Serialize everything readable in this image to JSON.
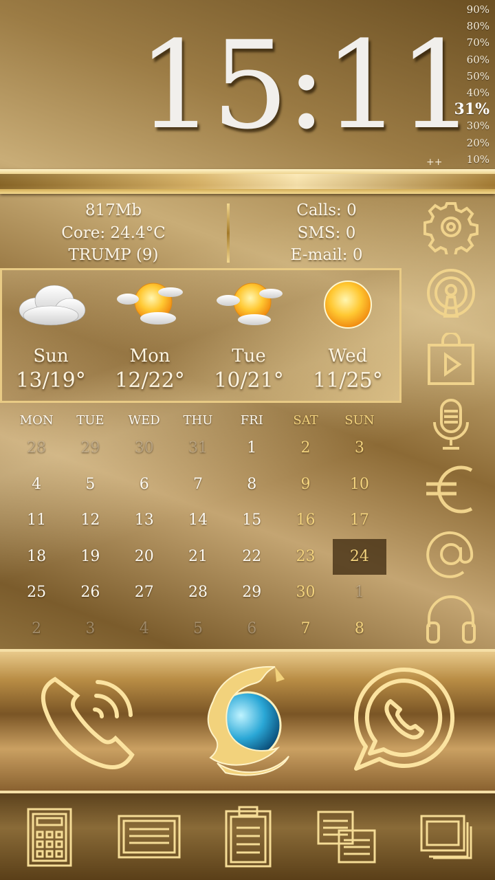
{
  "clock": {
    "time": "15:11"
  },
  "battery": {
    "scale": [
      "90%",
      "80%",
      "70%",
      "60%",
      "50%",
      "40%",
      "31%",
      "30%",
      "20%",
      "10%"
    ],
    "current_index": 6,
    "charging_mark": "++"
  },
  "info": {
    "memory": "817Mb",
    "core_temp": "Core: 24.4°C",
    "location": "TRUMP (9)",
    "calls": "Calls: 0",
    "sms": "SMS: 0",
    "email": "E-mail: 0"
  },
  "weather": [
    {
      "day": "Sun",
      "temp": "13/19°",
      "icon": "cloud-icon"
    },
    {
      "day": "Mon",
      "temp": "12/22°",
      "icon": "partly-sunny-icon"
    },
    {
      "day": "Tue",
      "temp": "10/21°",
      "icon": "partly-sunny-icon"
    },
    {
      "day": "Wed",
      "temp": "11/25°",
      "icon": "sun-icon"
    }
  ],
  "calendar": {
    "headers": [
      "MON",
      "TUE",
      "WED",
      "THU",
      "FRI",
      "SAT",
      "SUN"
    ],
    "weeks": [
      [
        "28",
        "29",
        "30",
        "31",
        "1",
        "2",
        "3"
      ],
      [
        "4",
        "5",
        "6",
        "7",
        "8",
        "9",
        "10"
      ],
      [
        "11",
        "12",
        "13",
        "14",
        "15",
        "16",
        "17"
      ],
      [
        "18",
        "19",
        "20",
        "21",
        "22",
        "23",
        "24"
      ],
      [
        "25",
        "26",
        "27",
        "28",
        "29",
        "30",
        "1"
      ],
      [
        "2",
        "3",
        "4",
        "5",
        "6",
        "7",
        "8"
      ]
    ],
    "today": "24"
  },
  "side_icons": [
    "settings-icon",
    "podcast-icon",
    "play-store-icon",
    "microphone-icon",
    "euro-icon",
    "email-at-icon",
    "headphones-icon"
  ],
  "dock": [
    "phone-icon",
    "firefox-icon",
    "whatsapp-icon"
  ],
  "bottom_bar": [
    "calculator-icon",
    "notes-icon",
    "clipboard-icon",
    "copy-icon",
    "windows-icon"
  ],
  "colors": {
    "gold": "#e0bb62",
    "gold_light": "#f5dfa6",
    "today_bg": "#3c280f",
    "text": "#fdfaf2"
  }
}
